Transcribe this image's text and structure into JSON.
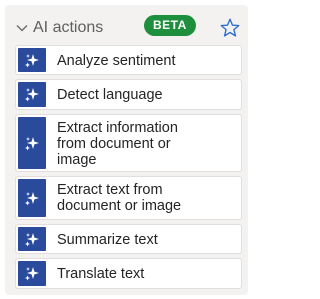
{
  "section": {
    "title": "AI actions",
    "badge": "BETA"
  },
  "icons": {
    "collapse": "chevron-down-icon",
    "favorite": "star-outline-icon",
    "item": "sparkle-icon"
  },
  "colors": {
    "badge": "#1e8f3c",
    "icon_tile": "#2a4b9b",
    "star": "#2f6dcc"
  },
  "items": [
    {
      "label": "Analyze sentiment"
    },
    {
      "label": "Detect language"
    },
    {
      "label": "Extract information from document or image"
    },
    {
      "label": "Extract text from document or image"
    },
    {
      "label": "Summarize text"
    },
    {
      "label": "Translate text"
    }
  ]
}
